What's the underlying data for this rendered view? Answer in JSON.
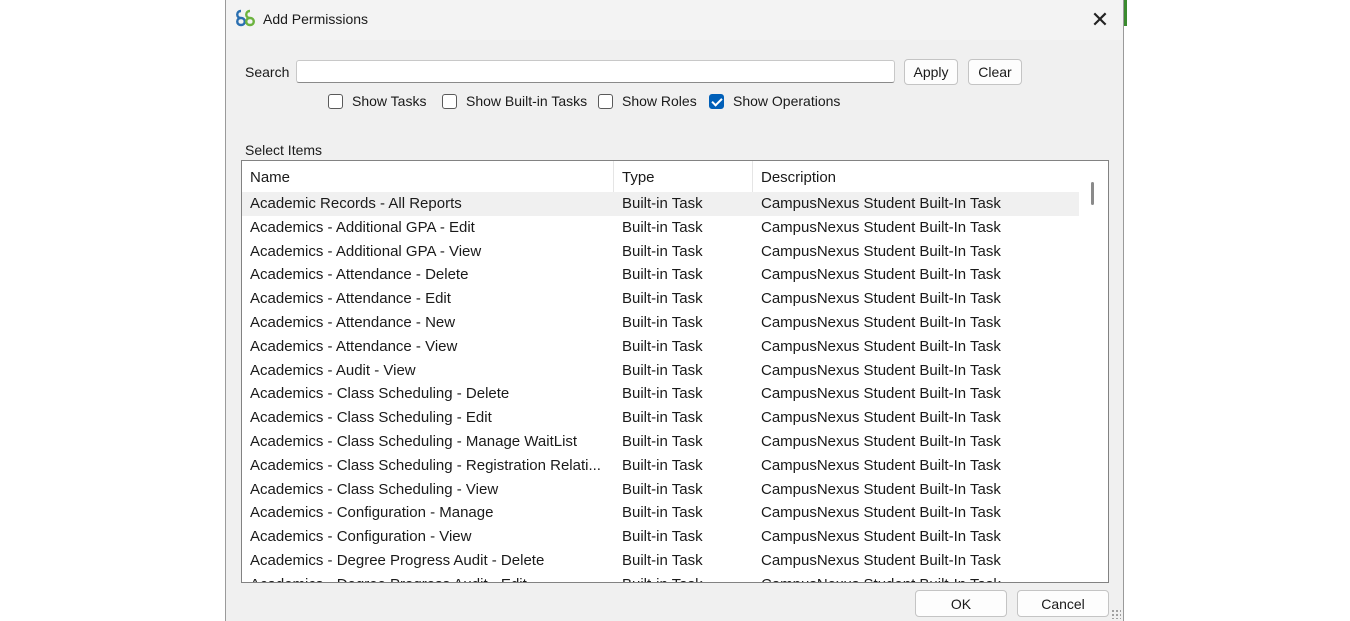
{
  "window": {
    "title": "Add Permissions",
    "close_symbol": "✕"
  },
  "search": {
    "label": "Search",
    "value": "",
    "placeholder": ""
  },
  "buttons": {
    "apply": "Apply",
    "clear": "Clear",
    "ok": "OK",
    "cancel": "Cancel"
  },
  "filters": [
    {
      "label": "Show Tasks",
      "checked": false
    },
    {
      "label": "Show Built-in Tasks",
      "checked": false
    },
    {
      "label": "Show Roles",
      "checked": false
    },
    {
      "label": "Show Operations",
      "checked": true
    }
  ],
  "list": {
    "label": "Select Items",
    "columns": [
      "Name",
      "Type",
      "Description"
    ],
    "selected_index": 0,
    "rows": [
      [
        "Academic Records - All Reports",
        "Built-in Task",
        "CampusNexus Student Built-In Task"
      ],
      [
        "Academics - Additional GPA - Edit",
        "Built-in Task",
        "CampusNexus Student Built-In Task"
      ],
      [
        "Academics - Additional GPA - View",
        "Built-in Task",
        "CampusNexus Student Built-In Task"
      ],
      [
        "Academics - Attendance - Delete",
        "Built-in Task",
        "CampusNexus Student Built-In Task"
      ],
      [
        "Academics - Attendance - Edit",
        "Built-in Task",
        "CampusNexus Student Built-In Task"
      ],
      [
        "Academics - Attendance - New",
        "Built-in Task",
        "CampusNexus Student Built-In Task"
      ],
      [
        "Academics - Attendance - View",
        "Built-in Task",
        "CampusNexus Student Built-In Task"
      ],
      [
        "Academics - Audit - View",
        "Built-in Task",
        "CampusNexus Student Built-In Task"
      ],
      [
        "Academics - Class Scheduling - Delete",
        "Built-in Task",
        "CampusNexus Student Built-In Task"
      ],
      [
        "Academics - Class Scheduling - Edit",
        "Built-in Task",
        "CampusNexus Student Built-In Task"
      ],
      [
        "Academics - Class Scheduling - Manage WaitList",
        "Built-in Task",
        "CampusNexus Student Built-In Task"
      ],
      [
        "Academics - Class Scheduling - Registration Relati...",
        "Built-in Task",
        "CampusNexus Student Built-In Task"
      ],
      [
        "Academics - Class Scheduling - View",
        "Built-in Task",
        "CampusNexus Student Built-In Task"
      ],
      [
        "Academics - Configuration - Manage",
        "Built-in Task",
        "CampusNexus Student Built-In Task"
      ],
      [
        "Academics - Configuration - View",
        "Built-in Task",
        "CampusNexus Student Built-In Task"
      ],
      [
        "Academics - Degree Progress Audit - Delete",
        "Built-in Task",
        "CampusNexus Student Built-In Task"
      ],
      [
        "Academics - Degree Progress Audit - Edit",
        "Built-in Task",
        "CampusNexus Student Built-In Task"
      ]
    ]
  },
  "colors": {
    "accent": "#005fb8",
    "dialog_bg": "#f0f0f0",
    "selected_row": "#f0f0f0"
  },
  "icons": {
    "app": "app-logo-icon",
    "close": "close-icon",
    "check": "checkmark-icon",
    "resize": "resize-grip-icon"
  }
}
